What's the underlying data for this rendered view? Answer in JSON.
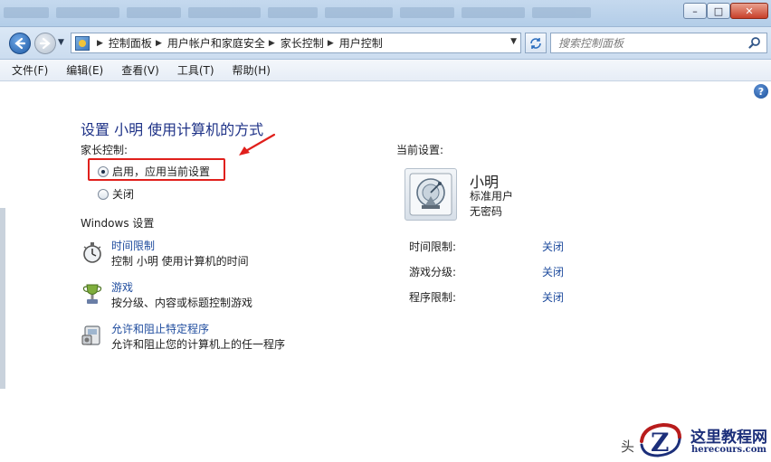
{
  "window": {
    "minimize_glyph": "–",
    "maximize_glyph": "□",
    "close_glyph": "✕"
  },
  "address_bar": {
    "breadcrumbs": [
      "控制面板",
      "用户帐户和家庭安全",
      "家长控制",
      "用户控制"
    ],
    "search_placeholder": "搜索控制面板"
  },
  "menu": [
    "文件(F)",
    "编辑(E)",
    "查看(V)",
    "工具(T)",
    "帮助(H)"
  ],
  "page": {
    "title": "设置 小明 使用计算机的方式",
    "parental_controls_label": "家长控制:",
    "option_on": "启用，应用当前设置",
    "option_off": "关闭",
    "selected_option": "on",
    "windows_settings_heading": "Windows 设置",
    "settings": [
      {
        "link": "时间限制",
        "desc": "控制 小明 使用计算机的时间",
        "icon": "stopwatch-icon"
      },
      {
        "link": "游戏",
        "desc": "按分级、内容或标题控制游戏",
        "icon": "trophy-icon"
      },
      {
        "link": "允许和阻止特定程序",
        "desc": "允许和阻止您的计算机上的任一程序",
        "icon": "program-icon"
      }
    ]
  },
  "current_settings": {
    "label": "当前设置:",
    "user_name": "小明",
    "user_type": "标准用户",
    "password": "无密码",
    "rows": [
      {
        "key": "时间限制:",
        "value": "关闭"
      },
      {
        "key": "游戏分级:",
        "value": "关闭"
      },
      {
        "key": "程序限制:",
        "value": "关闭"
      }
    ]
  },
  "help_glyph": "?",
  "watermark": {
    "side_char": "头",
    "logo_letter": "Z",
    "title": "这里教程网",
    "url": "herecours.com"
  },
  "colors": {
    "link": "#1f4c9e",
    "title": "#1e3287",
    "annotation": "#e0201c"
  }
}
